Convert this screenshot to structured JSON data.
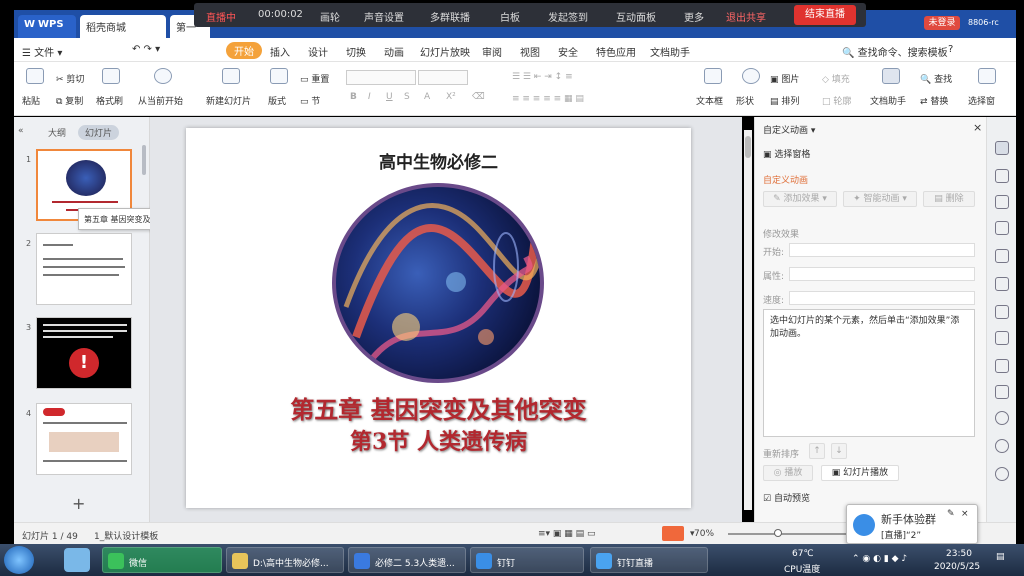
{
  "titlebar": {
    "tabs": [
      "WPS",
      "稻壳商城",
      "第一"
    ],
    "live": {
      "status": "直播中",
      "time": "00:00:02",
      "items": [
        "画轮",
        "声音设置",
        "多群联播",
        "白板",
        "发起签到",
        "互动面板",
        "更多"
      ],
      "exit_share": "退出共享",
      "end_live": "结束直播"
    },
    "login": "未登录",
    "user_id": "8806-rc"
  },
  "menubar": {
    "file": "文件",
    "items": [
      "开始",
      "插入",
      "设计",
      "切换",
      "动画",
      "幻灯片放映",
      "审阅",
      "视图",
      "安全",
      "特色应用",
      "文档助手"
    ],
    "active": "开始",
    "search": "查找命令、搜索模板"
  },
  "ribbon": {
    "paste": "粘贴",
    "cut": "剪切",
    "copy": "复制",
    "format_painter": "格式刷",
    "from_current": "从当前开始",
    "new_slide": "新建幻灯片",
    "layout": "版式",
    "reset": "重置",
    "section": "节",
    "textbox": "文本框",
    "shape": "形状",
    "picture": "图片",
    "fill": "填充",
    "arrange": "排列",
    "outline": "轮廓",
    "doc_assistant": "文档助手",
    "find": "查找",
    "replace": "替换",
    "select_pane": "选择窗"
  },
  "leftpanel": {
    "tabs": [
      "大纲",
      "幻灯片"
    ],
    "active_tab": "幻灯片",
    "slides": [
      "1",
      "2",
      "3",
      "4"
    ],
    "tooltip": "第五章 基因突变及其他突变第3节 ...",
    "add": "+"
  },
  "slide": {
    "title": "高中生物必修二",
    "chapter": "第五章 基因突变及其他突变",
    "section": "第3节  人类遗传病"
  },
  "animpanel": {
    "header": "自定义动画",
    "select_pane": "选择窗格",
    "section_title": "自定义动画",
    "add_effect": "添加效果",
    "smart_anim": "智能动画",
    "delete": "删除",
    "modify_title": "修改效果",
    "start_label": "开始:",
    "property_label": "属性:",
    "speed_label": "速度:",
    "hint": "选中幻灯片的某个元素，然后单击“添加效果”添加动画。",
    "reorder": "重新排序",
    "play": "播放",
    "slideshow": "幻灯片播放",
    "autopreview": "自动预览"
  },
  "statusbar": {
    "slide_count": "幻灯片 1 / 49",
    "template": "1_默认设计模板",
    "zoom": "70%"
  },
  "notification": {
    "title": "新手体验群",
    "message": "[直播]“2”"
  },
  "taskbar": {
    "items": [
      "微信",
      "D:\\高中生物必修...",
      "必修二 5.3人类遗...",
      "钉钉",
      "钉钉直播"
    ],
    "cpu_temp": "67℃",
    "cpu_label": "CPU温度",
    "time": "23:50",
    "date": "2020/5/25"
  },
  "colors": {
    "accent": "#f4a23b",
    "wps_blue": "#1f4fa6",
    "live_red": "#e0332f",
    "title_red": "#b2282f"
  }
}
